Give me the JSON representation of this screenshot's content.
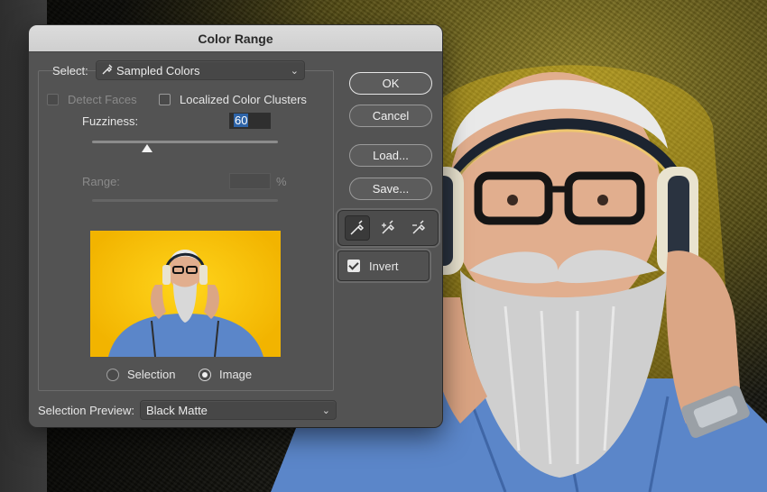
{
  "dialog": {
    "title": "Color Range",
    "select_label": "Select:",
    "select_value": "Sampled Colors",
    "detect_faces_label": "Detect Faces",
    "localized_label": "Localized Color Clusters",
    "fuzziness_label": "Fuzziness:",
    "fuzziness_value": "60",
    "fuzziness_fraction": 0.3,
    "range_label": "Range:",
    "range_unit": "%",
    "radio_selection": "Selection",
    "radio_image": "Image",
    "preview_mode": "image",
    "selection_preview_label": "Selection Preview:",
    "selection_preview_value": "Black Matte",
    "invert_label": "Invert",
    "invert_checked": true
  },
  "buttons": {
    "ok": "OK",
    "cancel": "Cancel",
    "load": "Load...",
    "save": "Save..."
  },
  "tools": [
    "eyedropper-icon",
    "eyedropper-plus-icon",
    "eyedropper-minus-icon"
  ],
  "colors": {
    "dialog_bg": "#535353",
    "preview_bg": "#f7c511",
    "shirt": "#5b86c9"
  }
}
